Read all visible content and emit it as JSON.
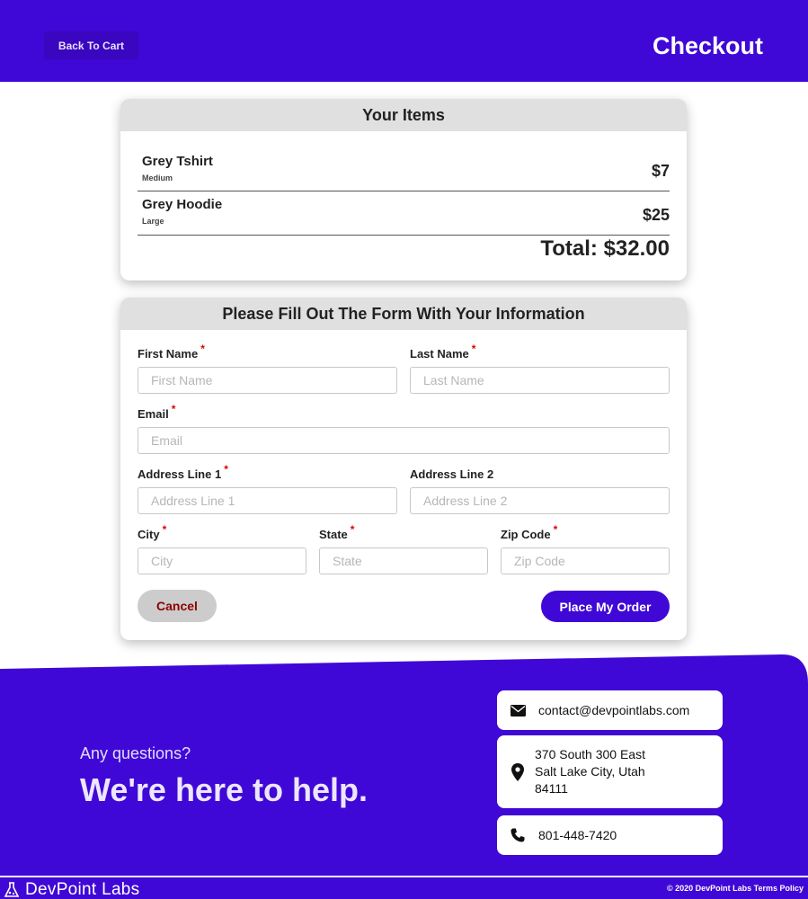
{
  "header": {
    "back_label": "Back To Cart",
    "title": "Checkout"
  },
  "items_card": {
    "title": "Your Items",
    "items": [
      {
        "name": "Grey Tshirt",
        "size": "Medium",
        "price": "$7"
      },
      {
        "name": "Grey Hoodie",
        "size": "Large",
        "price": "$25"
      }
    ],
    "total": "Total: $32.00"
  },
  "form": {
    "title": "Please Fill Out The Form With Your Information",
    "required_mark": "*",
    "fields": {
      "first_name": {
        "label": "First Name",
        "placeholder": "First Name",
        "value": ""
      },
      "last_name": {
        "label": "Last Name",
        "placeholder": "Last Name",
        "value": ""
      },
      "email": {
        "label": "Email",
        "placeholder": "Email",
        "value": ""
      },
      "address1": {
        "label": "Address Line 1",
        "placeholder": "Address Line 1",
        "value": ""
      },
      "address2": {
        "label": "Address Line 2",
        "placeholder": "Address Line 2",
        "value": ""
      },
      "city": {
        "label": "City",
        "placeholder": "City",
        "value": ""
      },
      "state": {
        "label": "State",
        "placeholder": "State",
        "value": ""
      },
      "zip": {
        "label": "Zip Code",
        "placeholder": "Zip Code",
        "value": ""
      }
    },
    "cancel_label": "Cancel",
    "submit_label": "Place My Order"
  },
  "footer": {
    "question": "Any questions?",
    "tagline": "We're here to help.",
    "contact": {
      "email": "contact@devpointlabs.com",
      "address_line1": "370 South 300 East",
      "address_line2": "Salt Lake City, Utah",
      "address_line3": "84111",
      "phone": "801-448-7420"
    },
    "brand": "DevPoint Labs",
    "copyright": "© 2020 DevPoint Labs Terms Policy"
  },
  "colors": {
    "brand_purple": "#4008d6",
    "required_red": "#e00000",
    "cancel_text": "#8b0000"
  },
  "icons": [
    "envelope-icon",
    "map-pin-icon",
    "phone-icon",
    "devpoint-logo-icon"
  ]
}
